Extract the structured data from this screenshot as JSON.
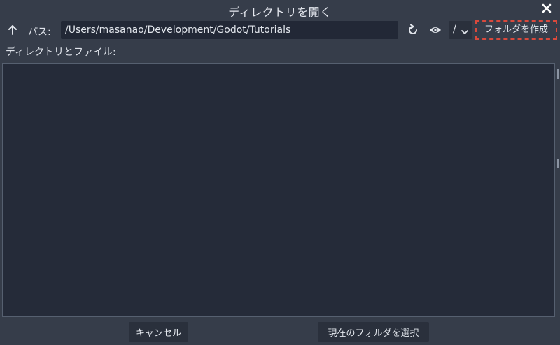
{
  "window": {
    "title": "ディレクトリを開く"
  },
  "toolbar": {
    "path_label": "パス:",
    "path_value": "/Users/masanao/Development/Godot/Tutorials",
    "drive_value": "/",
    "create_folder_label": "フォルダを作成"
  },
  "browser": {
    "section_label": "ディレクトリとファイル:"
  },
  "footer": {
    "cancel_label": "キャンセル",
    "select_label": "現在のフォルダを選択"
  },
  "icons": {
    "close": "close-icon",
    "up": "arrow-up-icon",
    "refresh": "refresh-icon",
    "toggle_hidden": "eye-icon",
    "dropdown": "chevron-down-icon"
  },
  "colors": {
    "background": "#363d4a",
    "panel": "#252b39",
    "input": "#222836",
    "highlight_border": "#d9493c"
  }
}
